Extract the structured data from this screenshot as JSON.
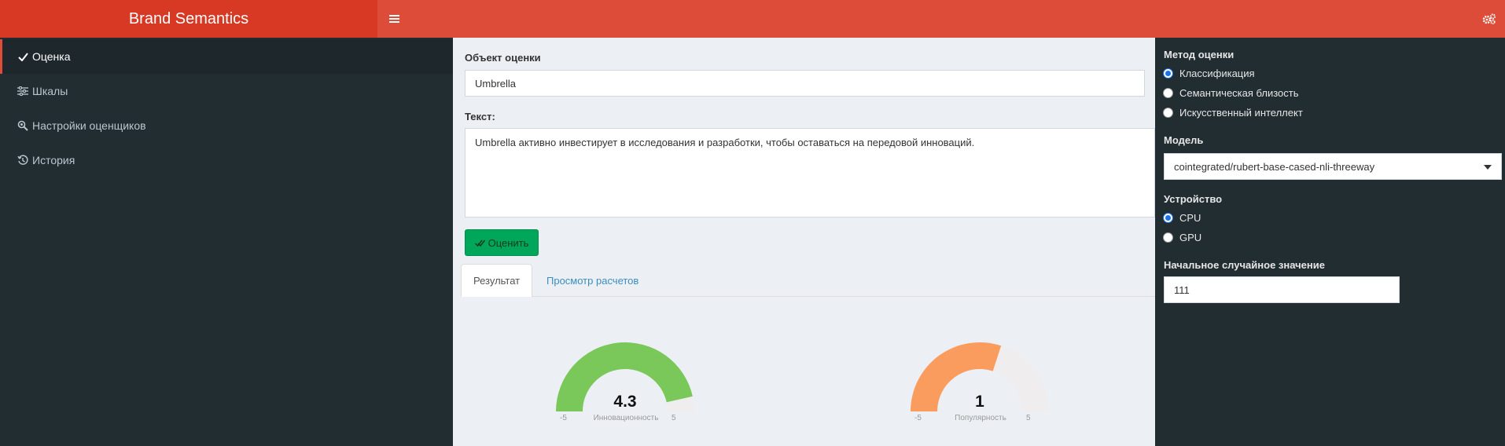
{
  "header": {
    "brand": "Brand Semantics",
    "toggle_icon": "hamburger-icon",
    "settings_icon": "gears-icon",
    "color": "#dd4b39",
    "brand_color": "#d73925"
  },
  "sidebar": {
    "items": [
      {
        "label": "Оценка",
        "icon": "check-icon",
        "active": true
      },
      {
        "label": "Шкалы",
        "icon": "sliders-icon",
        "active": false
      },
      {
        "label": "Настройки оценщиков",
        "icon": "search-gear-icon",
        "active": false
      },
      {
        "label": "История",
        "icon": "history-icon",
        "active": false
      }
    ]
  },
  "main": {
    "object_label": "Объект оценки",
    "object_value": "Umbrella",
    "text_label": "Текст:",
    "text_value": "Umbrella активно инвестирует в исследования и разработки, чтобы оставаться на передовой инноваций.",
    "evaluate_button": "Оценить",
    "tabs": [
      {
        "label": "Результат",
        "active": true
      },
      {
        "label": "Просмотр расчетов",
        "active": false
      }
    ],
    "gauges": [
      {
        "value": "4.3",
        "min": "-5",
        "max": "5",
        "name": "Инновационность",
        "numeric": 4.3,
        "color": "#7ac85a"
      },
      {
        "value": "1",
        "min": "-5",
        "max": "5",
        "name": "Популярность",
        "numeric": 1,
        "color": "#fa9c5e"
      }
    ]
  },
  "right_panel": {
    "method_label": "Метод оценки",
    "methods": [
      {
        "label": "Классификация",
        "selected": true
      },
      {
        "label": "Семантическая близость",
        "selected": false
      },
      {
        "label": "Искусственный интеллект",
        "selected": false
      }
    ],
    "model_label": "Модель",
    "model_value": "cointegrated/rubert-base-cased-nli-threeway",
    "device_label": "Устройство",
    "devices": [
      {
        "label": "CPU",
        "selected": true
      },
      {
        "label": "GPU",
        "selected": false
      }
    ],
    "seed_label": "Начальное случайное значение",
    "seed_value": "111"
  }
}
